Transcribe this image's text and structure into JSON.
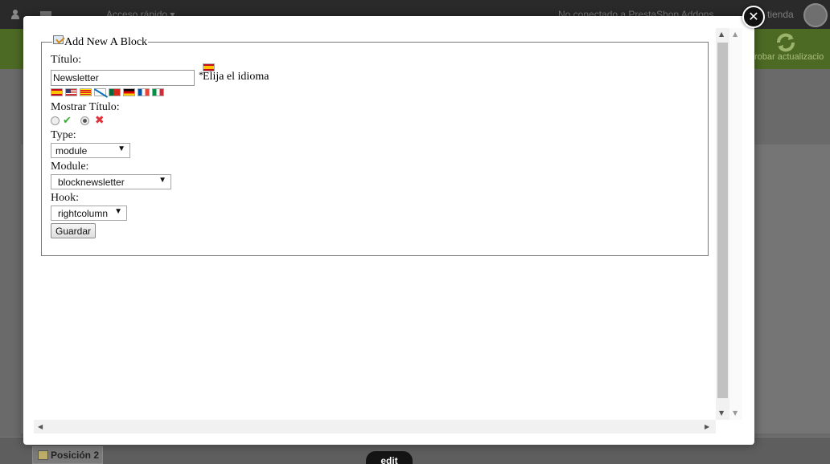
{
  "background": {
    "quick_access": "Acceso rápido ▾",
    "addons_status": "No conectado a PrestaShop Addons",
    "store": "tienda",
    "update": "robar actualizacio",
    "position_tab": "Posición 2",
    "edit_tab": "edit"
  },
  "form": {
    "legend": "Add New A Block",
    "title_label": "Título:",
    "title_value": "Newsletter",
    "required_mark": "*",
    "choose_language": "Elija el idioma",
    "languages": [
      "es",
      "en",
      "ca",
      "gl",
      "pt",
      "de",
      "fr",
      "it"
    ],
    "show_title_label": "Mostrar Título:",
    "show_title_selected": "no",
    "type_label": "Type:",
    "type_value": "module",
    "module_label": "Module:",
    "module_value": "blocknewsletter",
    "hook_label": "Hook:",
    "hook_value": "rightcolumn",
    "save_label": "Guardar"
  },
  "icons": {
    "close": "close-icon",
    "yes": "check-icon",
    "no": "cross-icon",
    "legend": "edit-icon"
  },
  "colors": {
    "check": "#3cab3c",
    "cross": "#e0313a"
  }
}
